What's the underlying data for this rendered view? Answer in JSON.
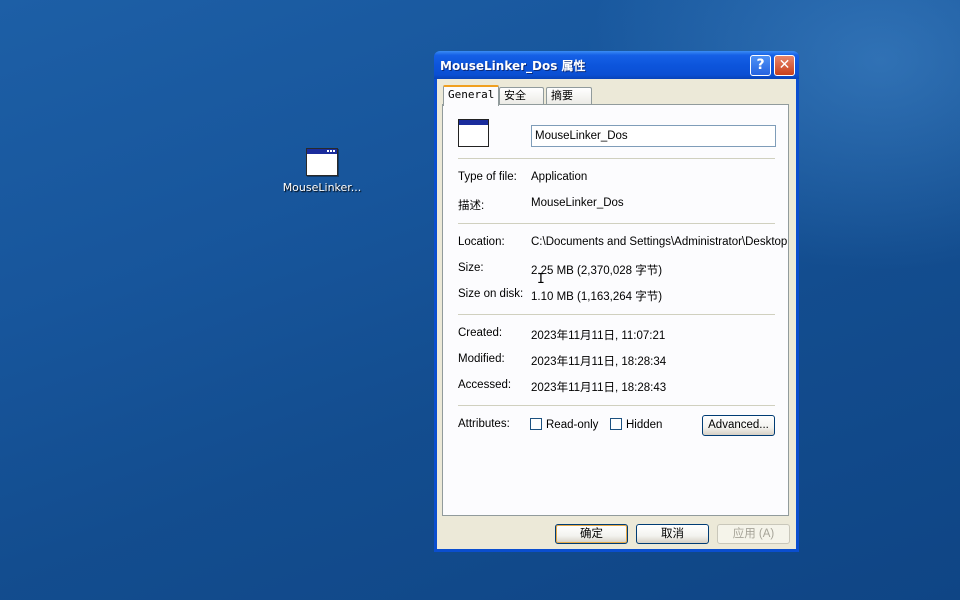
{
  "desktop": {
    "icon_label": "MouseLinker..."
  },
  "window": {
    "title": "MouseLinker_Dos 属性",
    "help_glyph": "?",
    "close_glyph": "✕",
    "tabs": [
      {
        "label": "General"
      },
      {
        "label": "安全"
      },
      {
        "label": "摘要"
      }
    ],
    "name_value": "MouseLinker_Dos",
    "type_label": "Type of file:",
    "type_value": "Application",
    "desc_label": "描述:",
    "desc_value": "MouseLinker_Dos",
    "location_label": "Location:",
    "location_value": "C:\\Documents and Settings\\Administrator\\Desktop",
    "size_label": "Size:",
    "size_value": "2.25 MB (2,370,028 字节)",
    "size_on_disk_label": "Size on disk:",
    "size_on_disk_value": "1.10 MB (1,163,264 字节)",
    "created_label": "Created:",
    "created_value": "2023年11月11日, 11:07:21",
    "modified_label": "Modified:",
    "modified_value": "2023年11月11日, 18:28:34",
    "accessed_label": "Accessed:",
    "accessed_value": "2023年11月11日, 18:28:43",
    "attributes_label": "Attributes:",
    "readonly_label": "Read-only",
    "hidden_label": "Hidden",
    "advanced_label": "Advanced...",
    "ok_label": "确定",
    "cancel_label": "取消",
    "apply_label": "应用 (A)"
  },
  "colors": {
    "title_bar": "#0a4fd3",
    "dialog_face": "#ece9d8",
    "desktop": "#17559b"
  }
}
